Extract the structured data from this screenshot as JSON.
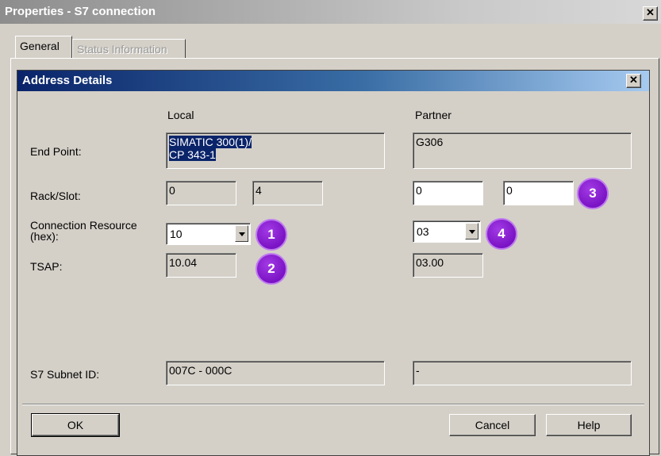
{
  "window": {
    "title": "Properties - S7 connection",
    "close_glyph": "✕"
  },
  "tabs": [
    {
      "label": "General",
      "active": true
    },
    {
      "label": "Status Information",
      "active": false
    }
  ],
  "dialog": {
    "title": "Address Details",
    "close_glyph": "✕",
    "col_local": "Local",
    "col_partner": "Partner",
    "labels": {
      "end_point": "End Point:",
      "rack_slot": "Rack/Slot:",
      "conn_res_1": "Connection Resource",
      "conn_res_2": "(hex):",
      "tsap": "TSAP:",
      "subnet": "S7 Subnet ID:"
    },
    "local": {
      "end_point_line1": "SIMATIC 300(1)/",
      "end_point_line2": "CP 343-1",
      "rack": "0",
      "slot": "4",
      "conn_resource": "10",
      "tsap": "10.04",
      "subnet": "007C - 000C"
    },
    "partner": {
      "end_point": "G306",
      "rack": "0",
      "slot": "0",
      "conn_resource": "03",
      "tsap": "03.00",
      "subnet": "-"
    },
    "badges": [
      "1",
      "2",
      "3",
      "4"
    ],
    "buttons": {
      "ok": "OK",
      "cancel": "Cancel",
      "help": "Help"
    }
  },
  "colors": {
    "titlebar_active": "#0a246a",
    "titlebar_inactive": "#8d8d8d",
    "face": "#d4d0c8",
    "badge": "#7a13c4"
  }
}
